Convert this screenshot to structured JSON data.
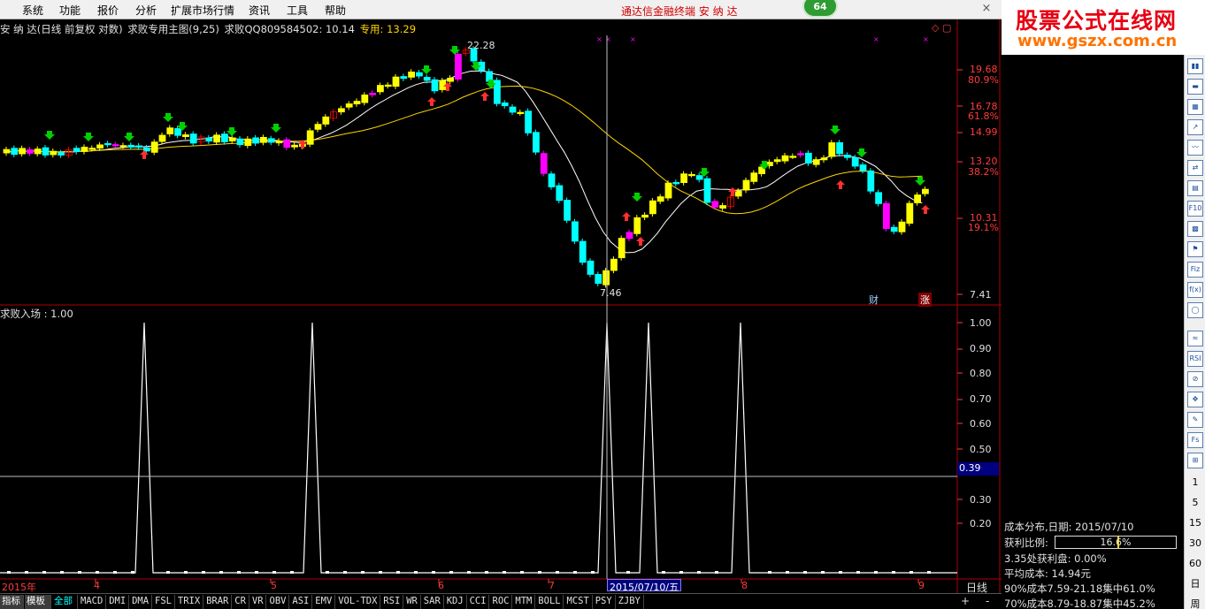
{
  "menu": {
    "items": [
      "系统",
      "功能",
      "报价",
      "分析",
      "扩展市场行情",
      "资讯",
      "工具",
      "帮助"
    ],
    "app_title": "通达信金融终端   安 纳 达",
    "badge": "64",
    "close_glyph": "×"
  },
  "watermark": {
    "line1": "股票公式在线网",
    "line2": "www.gszx.com.cn"
  },
  "main_chart": {
    "stock_label": "安 纳 达(日线 前复权 对数)",
    "indicator_label": "求败专用主图(9,25)",
    "qq_label": "求败QQ809584502: 10.14",
    "special_label": "专用: 13.29",
    "high_label": "22.28",
    "low_label": "7.46",
    "price_axis": [
      "19.68",
      "16.78",
      "14.99",
      "13.20",
      "10.31",
      "7.41"
    ],
    "pct_axis": [
      "80.9%",
      "61.8%",
      "38.2%",
      "19.1%"
    ],
    "badge_cai": "财",
    "badge_zhang": "涨",
    "corner_icons": "◇ ▢"
  },
  "sub_chart": {
    "title": "求败入场 : 1.00",
    "axis": [
      "1.00",
      "0.90",
      "0.80",
      "0.70",
      "0.60",
      "0.50",
      "0.39",
      "0.30",
      "0.20"
    ],
    "cursor_value": "0.39"
  },
  "date_axis": {
    "labels": [
      "2015年",
      "4",
      "5",
      "6",
      "7",
      "8",
      "9"
    ],
    "cursor_date": "2015/07/10/五",
    "period": "日线"
  },
  "tabs": {
    "mode": [
      "指标",
      "模板"
    ],
    "active": "全部",
    "items": [
      "MACD",
      "DMI",
      "DMA",
      "FSL",
      "TRIX",
      "BRAR",
      "CR",
      "VR",
      "OBV",
      "ASI",
      "EMV",
      "VOL-TDX",
      "RSI",
      "WR",
      "SAR",
      "KDJ",
      "CCI",
      "ROC",
      "MTM",
      "BOLL",
      "MCST",
      "PSY",
      "ZJBY"
    ],
    "plus": "+",
    "minus": "-"
  },
  "cost_panel": {
    "title": "成本分布,日期: 2015/07/10",
    "profit_label": "获利比例:",
    "profit_value": "16.6%",
    "profit_ratio": 0.166,
    "at_price": "3.35处获利盘: 0.00%",
    "avg_cost": "平均成本: 14.94元",
    "cost90": "90%成本7.59-21.18集中61.0%",
    "cost70": "70%成本8.79-18.87集中45.2%"
  },
  "toolbar": {
    "icons": [
      "chart-bar-icon",
      "candle-icon",
      "tile-icon",
      "trend-icon",
      "line-icon",
      "compare-icon",
      "doc-icon",
      "f10-icon",
      "grid-icon",
      "flag-icon",
      "fiz-icon",
      "fx-icon",
      "circle-icon",
      "wave-icon",
      "rsi-icon",
      "stop-icon",
      "move-icon",
      "pen-icon",
      "fs-icon",
      "fit-icon"
    ],
    "labels": [
      "1",
      "5",
      "15",
      "30",
      "60",
      "日",
      "周"
    ]
  },
  "colors": {
    "up": "#ffff00",
    "down": "#00ffff",
    "up_signal": "#ff00ff",
    "red_bar": "#ff0000",
    "ma_short": "#ffffff",
    "ma_long": "#ffd400",
    "axis": "#ff3b3b",
    "grid_line": "#b00000"
  }
}
